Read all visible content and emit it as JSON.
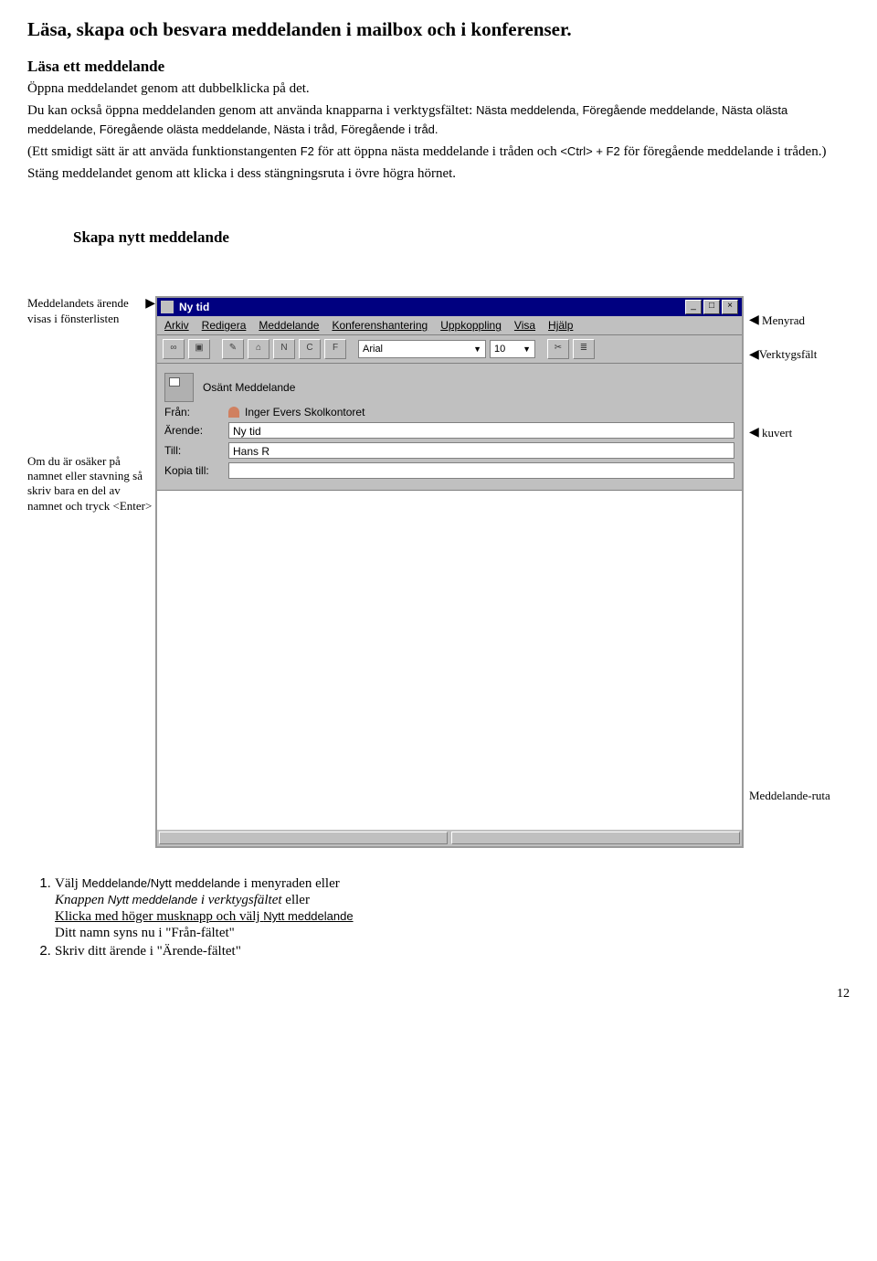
{
  "title": "Läsa, skapa och besvara meddelanden i mailbox och i konferenser.",
  "section1": {
    "heading": "Läsa ett meddelande",
    "p1": "Öppna meddelandet genom att dubbelklicka på det.",
    "p2a": "Du kan också öppna meddelanden genom att använda knapparna i verktygsfältet: ",
    "p2b": "Nästa meddelenda, Föregående meddelande, Nästa olästa meddelande, Föregående olästa meddelande,  Nästa i tråd, Föregående i tråd.",
    "p3a": "(Ett smidigt sätt är att anväda funktionstangenten ",
    "p3b": "F2",
    "p3c": " för att öppna nästa meddelande i tråden och ",
    "p3d": "<Ctrl> + F2",
    "p3e": " för föregående meddelande i tråden.)",
    "p4": "Stäng meddelandet genom att klicka i dess stängningsruta i övre högra hörnet."
  },
  "section2": {
    "heading": "Skapa nytt meddelande"
  },
  "leftnotes": {
    "n1": "Meddelandets ärende visas i fönsterlisten",
    "n2": "Om du är osäker på namnet eller stavning så skriv bara en del av namnet och tryck <Enter>"
  },
  "rightnotes": {
    "n1": "Menyrad",
    "n2": "Verktygsfält",
    "n3": "kuvert",
    "n4": "Meddelande-ruta"
  },
  "window": {
    "title": "Ny tid",
    "controls": {
      "min": "_",
      "max": "□",
      "close": "×"
    },
    "menu": [
      "Arkiv",
      "Redigera",
      "Meddelande",
      "Konferenshantering",
      "Uppkoppling",
      "Visa",
      "Hjälp"
    ],
    "toolbar": {
      "font": "Arial",
      "size": "10",
      "letters": [
        "N",
        "C",
        "F"
      ]
    },
    "header": {
      "status": "Osänt Meddelande",
      "from_label": "Från:",
      "from_value": "Inger Evers Skolkontoret",
      "subject_label": "Ärende:",
      "subject_value": "Ny tid",
      "to_label": "Till:",
      "to_value": "Hans R",
      "cc_label": "Kopia till:",
      "cc_value": ""
    }
  },
  "steps": {
    "s1a": "Välj ",
    "s1b": "Meddelande/Nytt meddelande",
    "s1c": " i menyraden eller",
    "s1d": "Knappen ",
    "s1e": "Nytt meddelande ",
    "s1f": "i verktygsfältet",
    "s1g": "  eller",
    "s1h": "Klicka med höger musknapp och välj ",
    "s1i": "Nytt meddelande",
    "s1j": " Ditt namn syns nu i \"Från-fältet\"",
    "s2": "Skriv ditt ärende i \"Ärende-fältet\""
  },
  "pagenum": "12"
}
